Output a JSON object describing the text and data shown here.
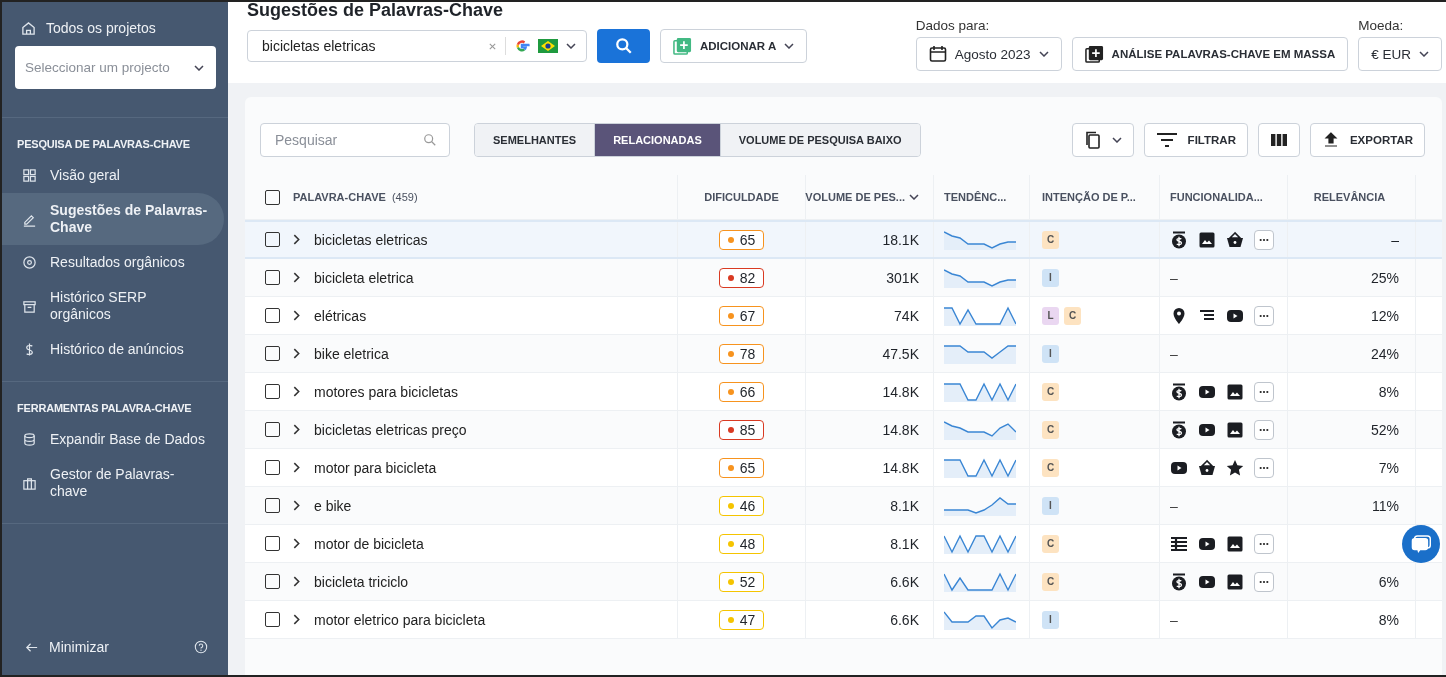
{
  "sidebar": {
    "all_projects": "Todos os projetos",
    "project_select": {
      "placeholder": "Seleccionar um projecto"
    },
    "sections": [
      {
        "title": "PESQUISA DE PALAVRAS-CHAVE",
        "items": [
          {
            "label": "Visão geral",
            "kind": "grid",
            "selected": false
          },
          {
            "label": "Sugestões de Palavras-Chave",
            "kind": "pen",
            "selected": true
          },
          {
            "label": "Resultados orgânicos",
            "kind": "target",
            "selected": false
          },
          {
            "label": "Histórico SERP orgânicos",
            "kind": "archive",
            "selected": false
          },
          {
            "label": "Histórico de anúncios",
            "kind": "dollar",
            "selected": false
          }
        ]
      },
      {
        "title": "FERRAMENTAS PALAVRA-CHAVE",
        "items": [
          {
            "label": "Expandir Base de Dados",
            "kind": "database",
            "selected": false
          },
          {
            "label": "Gestor de Palavras-chave",
            "kind": "briefcase",
            "selected": false
          }
        ]
      }
    ],
    "minimize": "Minimizar"
  },
  "header": {
    "title": "Sugestões de Palavras-Chave",
    "search_value": "bicicletas eletricas",
    "add_to": "ADICIONAR A",
    "data_for_label": "Dados para:",
    "date": "Agosto 2023",
    "bulk": "ANÁLISE PALAVRAS-CHAVE EM MASSA",
    "currency_label": "Moeda:",
    "currency": "€ EUR"
  },
  "toolbar": {
    "search": {
      "placeholder": "Pesquisar"
    },
    "tabs": [
      {
        "label": "SEMELHANTES",
        "selected": false
      },
      {
        "label": "RELACIONADAS",
        "selected": true
      },
      {
        "label": "VOLUME DE PESQUISA BAIXO",
        "selected": false
      }
    ],
    "filter": "FILTRAR",
    "export": "EXPORTAR"
  },
  "table": {
    "select_all": {
      "checked": false
    },
    "columns": [
      {
        "label": "PALAVRA-CHAVE",
        "count": "(459)"
      },
      {
        "label": "DIFICULDADE"
      },
      {
        "label": "VOLUME DE PES..."
      },
      {
        "label": "TENDÊNC..."
      },
      {
        "label": "INTENÇÃO DE P..."
      },
      {
        "label": "FUNCIONALIDA..."
      },
      {
        "label": "RELEVÂNCIA"
      }
    ],
    "rows": [
      {
        "keyword": "bicicletas eletricas",
        "checked": false,
        "selected": true,
        "difficulty": "65",
        "color": "#f7931e",
        "volume": "18.1K",
        "intent": [
          {
            "label": "C",
            "color": "#fde3c1"
          }
        ],
        "features": [
          {
            "kind": "money"
          },
          {
            "kind": "image"
          },
          {
            "kind": "basket"
          },
          {
            "kind": "more"
          }
        ],
        "relevance": "–"
      },
      {
        "keyword": "bicicleta eletrica",
        "checked": false,
        "selected": false,
        "difficulty": "82",
        "color": "#d93a22",
        "volume": "301K",
        "intent": [
          {
            "label": "I",
            "color": "#cfe3f6"
          }
        ],
        "features": [
          {
            "kind": "none",
            "label": "–"
          }
        ],
        "relevance": "25%"
      },
      {
        "keyword": "elétricas",
        "checked": false,
        "selected": false,
        "difficulty": "67",
        "color": "#f7931e",
        "volume": "74K",
        "intent": [
          {
            "label": "L",
            "color": "#ead7f1"
          },
          {
            "label": "C",
            "color": "#fde3c1"
          }
        ],
        "features": [
          {
            "kind": "pin"
          },
          {
            "kind": "lines"
          },
          {
            "kind": "video"
          },
          {
            "kind": "more"
          }
        ],
        "relevance": "12%"
      },
      {
        "keyword": "bike eletrica",
        "checked": false,
        "selected": false,
        "difficulty": "78",
        "color": "#f7931e",
        "volume": "47.5K",
        "intent": [
          {
            "label": "I",
            "color": "#cfe3f6"
          }
        ],
        "features": [
          {
            "kind": "none",
            "label": "–"
          }
        ],
        "relevance": "24%"
      },
      {
        "keyword": "motores para bicicletas",
        "checked": false,
        "selected": false,
        "difficulty": "66",
        "color": "#f7931e",
        "volume": "14.8K",
        "intent": [
          {
            "label": "C",
            "color": "#fde3c1"
          }
        ],
        "features": [
          {
            "kind": "money"
          },
          {
            "kind": "video"
          },
          {
            "kind": "image"
          },
          {
            "kind": "more"
          }
        ],
        "relevance": "8%"
      },
      {
        "keyword": "bicicletas eletricas preço",
        "checked": false,
        "selected": false,
        "difficulty": "85",
        "color": "#d93a22",
        "volume": "14.8K",
        "intent": [
          {
            "label": "C",
            "color": "#fde3c1"
          }
        ],
        "features": [
          {
            "kind": "money"
          },
          {
            "kind": "video"
          },
          {
            "kind": "image"
          },
          {
            "kind": "more"
          }
        ],
        "relevance": "52%"
      },
      {
        "keyword": "motor para bicicleta",
        "checked": false,
        "selected": false,
        "difficulty": "65",
        "color": "#f7931e",
        "volume": "14.8K",
        "intent": [
          {
            "label": "C",
            "color": "#fde3c1"
          }
        ],
        "features": [
          {
            "kind": "video"
          },
          {
            "kind": "basket"
          },
          {
            "kind": "star"
          },
          {
            "kind": "more"
          }
        ],
        "relevance": "7%"
      },
      {
        "keyword": "e bike",
        "checked": false,
        "selected": false,
        "difficulty": "46",
        "color": "#f5c400",
        "volume": "8.1K",
        "intent": [
          {
            "label": "I",
            "color": "#cfe3f6"
          }
        ],
        "features": [
          {
            "kind": "none",
            "label": "–"
          }
        ],
        "relevance": "11%"
      },
      {
        "keyword": "motor de bicicleta",
        "checked": false,
        "selected": false,
        "difficulty": "48",
        "color": "#f5c400",
        "volume": "8.1K",
        "intent": [
          {
            "label": "C",
            "color": "#fde3c1"
          }
        ],
        "features": [
          {
            "kind": "table"
          },
          {
            "kind": "video"
          },
          {
            "kind": "image"
          },
          {
            "kind": "more"
          }
        ]
      },
      {
        "keyword": "bicicleta triciclo",
        "checked": false,
        "selected": false,
        "difficulty": "52",
        "color": "#f5c400",
        "volume": "6.6K",
        "intent": [
          {
            "label": "C",
            "color": "#fde3c1"
          }
        ],
        "features": [
          {
            "kind": "money"
          },
          {
            "kind": "video"
          },
          {
            "kind": "image"
          },
          {
            "kind": "more"
          }
        ],
        "relevance": "6%"
      },
      {
        "keyword": "motor eletrico para bicicleta",
        "checked": false,
        "selected": false,
        "difficulty": "47",
        "color": "#f5c400",
        "volume": "6.6K",
        "intent": [
          {
            "label": "I",
            "color": "#cfe3f6"
          }
        ],
        "features": [
          {
            "kind": "none",
            "label": "–"
          }
        ],
        "relevance": "8%"
      }
    ]
  }
}
